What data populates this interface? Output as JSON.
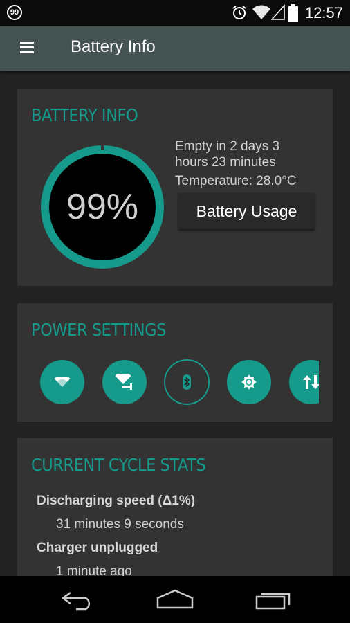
{
  "status_bar": {
    "notification_badge": "99",
    "time": "12:57",
    "icons": [
      "alarm-icon",
      "wifi-icon",
      "signal-icon",
      "battery-icon"
    ]
  },
  "app_bar": {
    "title": "Battery Info",
    "menu_icon": "hamburger-menu-icon"
  },
  "battery_card": {
    "heading": "BATTERY INFO",
    "percent_label": "99%",
    "level_fraction": 0.99,
    "empty_line1": "Empty in 2 days 3",
    "empty_line2": "hours 23 minutes",
    "temperature": "Temperature: 28.0°C",
    "usage_button": "Battery Usage",
    "accent_color": "#159a8c"
  },
  "power_card": {
    "heading": "POWER SETTINGS",
    "toggles": [
      {
        "name": "wifi",
        "icon": "wifi-icon",
        "state": "on"
      },
      {
        "name": "wifi-hotspot",
        "icon": "wifi-tethering-icon",
        "state": "on"
      },
      {
        "name": "bluetooth",
        "icon": "bluetooth-icon",
        "state": "off"
      },
      {
        "name": "brightness",
        "icon": "brightness-icon",
        "state": "on"
      },
      {
        "name": "mobile-data",
        "icon": "data-transfer-icon",
        "state": "on"
      }
    ]
  },
  "cycle_card": {
    "heading": "CURRENT CYCLE STATS",
    "stats": [
      {
        "label": "Discharging speed (Δ1%)",
        "value": "31 minutes 9 seconds"
      },
      {
        "label": "Charger unplugged",
        "value": "1 minute ago"
      }
    ]
  },
  "nav_bar": {
    "buttons": [
      "back-icon",
      "home-icon",
      "recent-apps-icon"
    ]
  }
}
